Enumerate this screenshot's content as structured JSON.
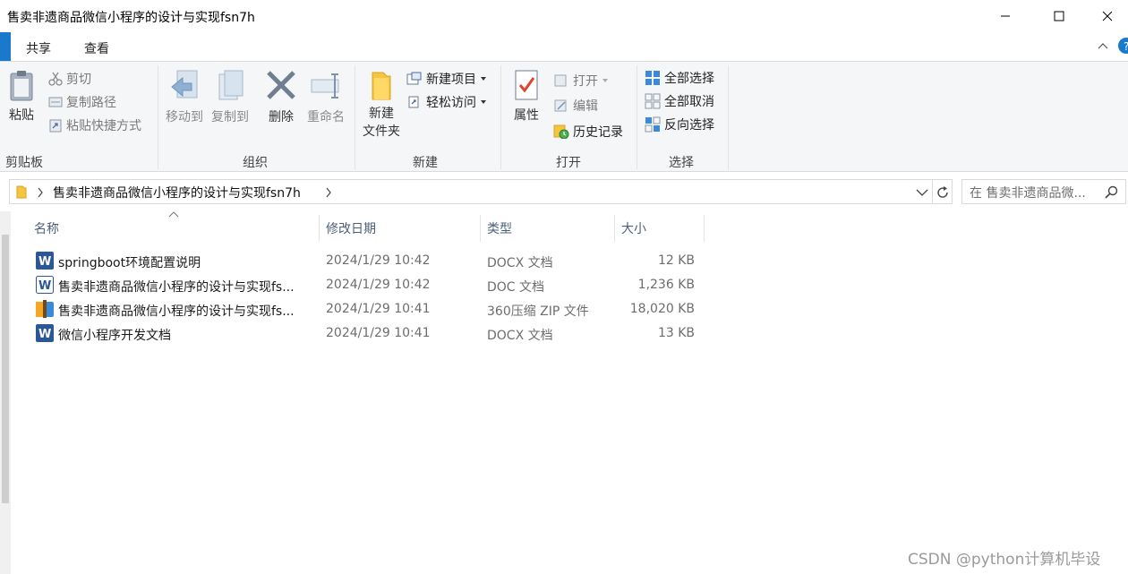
{
  "window": {
    "title": "售卖非遗商品微信小程序的设计与实现fsn7h"
  },
  "tabs": [
    {
      "label": "共享"
    },
    {
      "label": "查看"
    }
  ],
  "ribbon": {
    "clipboard": {
      "group_label": "剪贴板",
      "paste": "粘贴",
      "cut": "剪切",
      "copy_path": "复制路径",
      "paste_shortcut": "粘贴快捷方式"
    },
    "organize": {
      "group_label": "组织",
      "move_to": "移动到",
      "copy_to": "复制到",
      "delete": "删除",
      "rename": "重命名"
    },
    "new": {
      "group_label": "新建",
      "new_folder_line1": "新建",
      "new_folder_line2": "文件夹",
      "new_item": "新建项目",
      "easy_access": "轻松访问"
    },
    "open": {
      "group_label": "打开",
      "properties": "属性",
      "open": "打开",
      "edit": "编辑",
      "history": "历史记录"
    },
    "select": {
      "group_label": "选择",
      "select_all": "全部选择",
      "select_none": "全部取消",
      "invert": "反向选择"
    }
  },
  "address": {
    "path": "售卖非遗商品微信小程序的设计与实现fsn7h",
    "search_placeholder": "在 售卖非遗商品微..."
  },
  "columns": {
    "name": "名称",
    "date": "修改日期",
    "type": "类型",
    "size": "大小"
  },
  "files": [
    {
      "name": "springboot环境配置说明",
      "date": "2024/1/29 10:42",
      "type": "DOCX 文档",
      "size": "12 KB",
      "icon": "word-docx-icon"
    },
    {
      "name": "售卖非遗商品微信小程序的设计与实现fs...",
      "date": "2024/1/29 10:42",
      "type": "DOC 文档",
      "size": "1,236 KB",
      "icon": "word-doc-icon"
    },
    {
      "name": "售卖非遗商品微信小程序的设计与实现fs...",
      "date": "2024/1/29 10:41",
      "type": "360压缩 ZIP 文件",
      "size": "18,020 KB",
      "icon": "zip-archive-icon"
    },
    {
      "name": "微信小程序开发文档",
      "date": "2024/1/29 10:41",
      "type": "DOCX 文档",
      "size": "13 KB",
      "icon": "word-docx-icon"
    }
  ],
  "watermark": "CSDN @python计算机毕设",
  "colors": {
    "accent": "#1979ca",
    "word_blue": "#2b5797"
  }
}
